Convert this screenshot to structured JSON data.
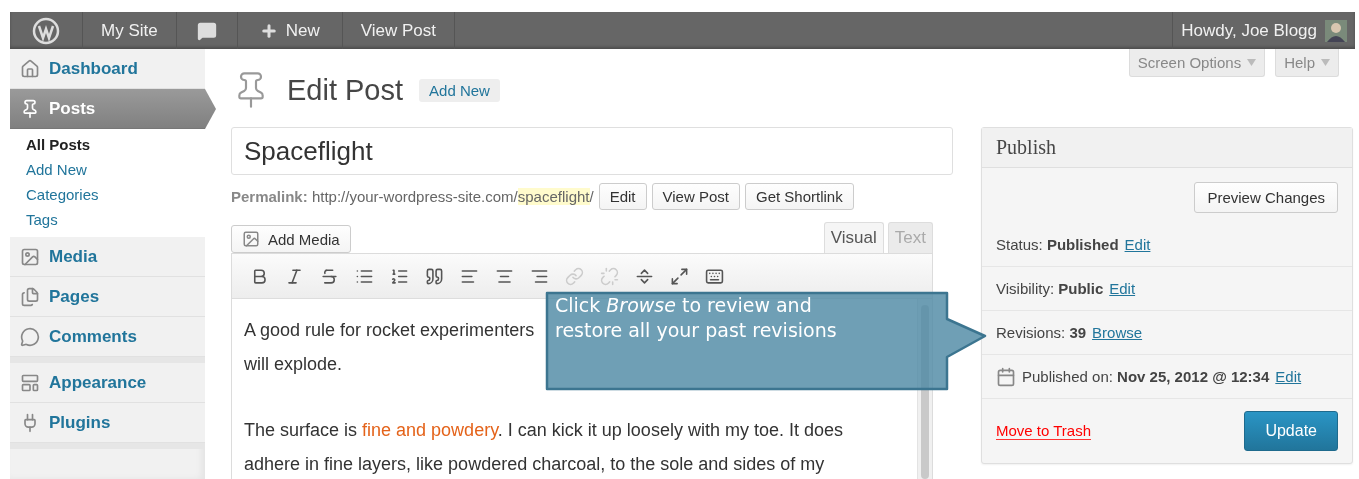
{
  "admin_bar": {
    "site": "My Site",
    "new": "New",
    "view_post": "View Post",
    "greeting": "Howdy, Joe Blogg"
  },
  "sidebar": {
    "groups": [
      [
        {
          "label": "Dashboard",
          "selected": false
        },
        {
          "label": "Posts",
          "selected": true,
          "children": [
            {
              "label": "All Posts",
              "selected": true
            },
            {
              "label": "Add New",
              "selected": false
            },
            {
              "label": "Categories",
              "selected": false
            },
            {
              "label": "Tags",
              "selected": false
            }
          ]
        },
        {
          "label": "Media",
          "selected": false
        },
        {
          "label": "Pages",
          "selected": false
        },
        {
          "label": "Comments",
          "selected": false
        }
      ],
      [
        {
          "label": "Appearance",
          "selected": false
        },
        {
          "label": "Plugins",
          "selected": false
        }
      ]
    ]
  },
  "screen_tabs": [
    "Screen Options",
    "Help"
  ],
  "header": {
    "title": "Edit Post",
    "add_new": "Add New"
  },
  "post_title": "Spaceflight",
  "permalink": {
    "label": "Permalink:",
    "base": "http://your-wordpress-site.com/",
    "slug": "spaceflight",
    "trailing": "/",
    "buttons": [
      "Edit",
      "View Post",
      "Get Shortlink"
    ]
  },
  "add_media": "Add Media",
  "editor_tabs": [
    {
      "label": "Visual",
      "selected": true
    },
    {
      "label": "Text",
      "selected": false
    }
  ],
  "editor": {
    "paragraphs": [
      [
        [
          {
            "kind": "plain",
            "text": "A good rule for rocket experimenters"
          }
        ],
        [
          {
            "kind": "plain",
            "text": "will explode."
          }
        ]
      ],
      [
        [
          {
            "kind": "plain",
            "text": "The surface is "
          },
          {
            "kind": "link",
            "text": "fine and powdery"
          },
          {
            "kind": "plain",
            "text": ". I can kick it up loosely with my toe. It does"
          }
        ],
        [
          {
            "kind": "plain",
            "text": "adhere in fine layers, like powdered charcoal, to the sole and sides of my"
          }
        ]
      ]
    ]
  },
  "tooltip": "Click *Browse* to review and restore all your past revisions",
  "publish": {
    "title": "Publish",
    "preview": "Preview Changes",
    "rows": [
      {
        "kind": "plain",
        "label": "Status:",
        "value": "Published",
        "link": "Edit"
      },
      {
        "kind": "plain",
        "label": "Visibility:",
        "value": "Public",
        "link": "Edit"
      },
      {
        "kind": "plain",
        "label": "Revisions:",
        "value": "39",
        "link": "Browse"
      },
      {
        "kind": "date",
        "label": "Published on:",
        "value": "Nov 25, 2012 @ 12:34",
        "link": "Edit"
      }
    ],
    "trash": "Move to Trash",
    "update": "Update"
  }
}
